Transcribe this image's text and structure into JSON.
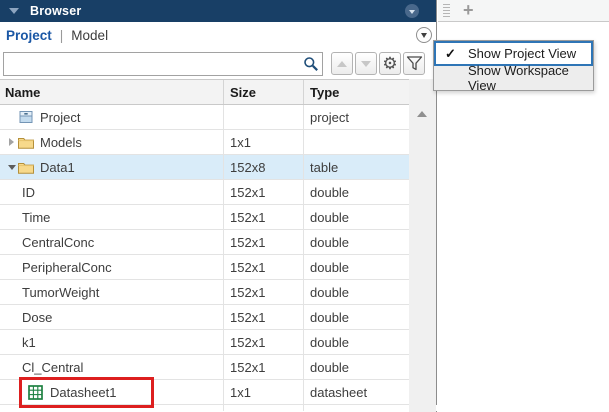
{
  "browser": {
    "title": "Browser",
    "tabs": [
      {
        "label": "Project",
        "active": true
      },
      {
        "label": "Model",
        "active": false
      }
    ],
    "search": {
      "value": "",
      "placeholder": ""
    },
    "toolbar": {
      "icons": [
        "search-icon",
        "move-up-icon",
        "move-down-icon",
        "gear-icon",
        "filter-icon"
      ]
    },
    "table": {
      "columns": [
        "Name",
        "Size",
        "Type"
      ],
      "rows": [
        {
          "name": "Project",
          "size": "",
          "type": "project",
          "icon": "project",
          "expander": "",
          "highlighted": false,
          "annotated": false
        },
        {
          "name": "Models",
          "size": "1x1",
          "type": "",
          "icon": "folder",
          "expander": "collapsed",
          "highlighted": false,
          "annotated": false
        },
        {
          "name": "Data1",
          "size": "152x8",
          "type": "table",
          "icon": "folder",
          "expander": "expanded",
          "highlighted": true,
          "annotated": false
        },
        {
          "name": "ID",
          "size": "152x1",
          "type": "double",
          "icon": "",
          "expander": "",
          "highlighted": false,
          "annotated": false
        },
        {
          "name": "Time",
          "size": "152x1",
          "type": "double",
          "icon": "",
          "expander": "",
          "highlighted": false,
          "annotated": false
        },
        {
          "name": "CentralConc",
          "size": "152x1",
          "type": "double",
          "icon": "",
          "expander": "",
          "highlighted": false,
          "annotated": false
        },
        {
          "name": "PeripheralConc",
          "size": "152x1",
          "type": "double",
          "icon": "",
          "expander": "",
          "highlighted": false,
          "annotated": false
        },
        {
          "name": "TumorWeight",
          "size": "152x1",
          "type": "double",
          "icon": "",
          "expander": "",
          "highlighted": false,
          "annotated": false
        },
        {
          "name": "Dose",
          "size": "152x1",
          "type": "double",
          "icon": "",
          "expander": "",
          "highlighted": false,
          "annotated": false
        },
        {
          "name": "k1",
          "size": "152x1",
          "type": "double",
          "icon": "",
          "expander": "",
          "highlighted": false,
          "annotated": false
        },
        {
          "name": "Cl_Central",
          "size": "152x1",
          "type": "double",
          "icon": "",
          "expander": "",
          "highlighted": false,
          "annotated": false
        },
        {
          "name": "Datasheet1",
          "size": "1x1",
          "type": "datasheet",
          "icon": "datasheet",
          "expander": "",
          "highlighted": false,
          "annotated": true
        }
      ]
    }
  },
  "menu": {
    "check_glyph": "✓",
    "items": [
      {
        "label": "Show Project View",
        "checked": true,
        "selected": true
      },
      {
        "label": "Show Workspace View",
        "checked": false,
        "selected": false
      }
    ]
  },
  "right_panel": {
    "plus_label": "+"
  },
  "colors": {
    "titlebar_bg": "#183f66",
    "row_highlight": "#d9ecf9",
    "menu_selection_border": "#2e75b6",
    "annotation_red": "#dd1f1f",
    "link_blue": "#1a57a5",
    "datasheet_green": "#1e8142",
    "folder_yellow": "#f7d98b"
  }
}
